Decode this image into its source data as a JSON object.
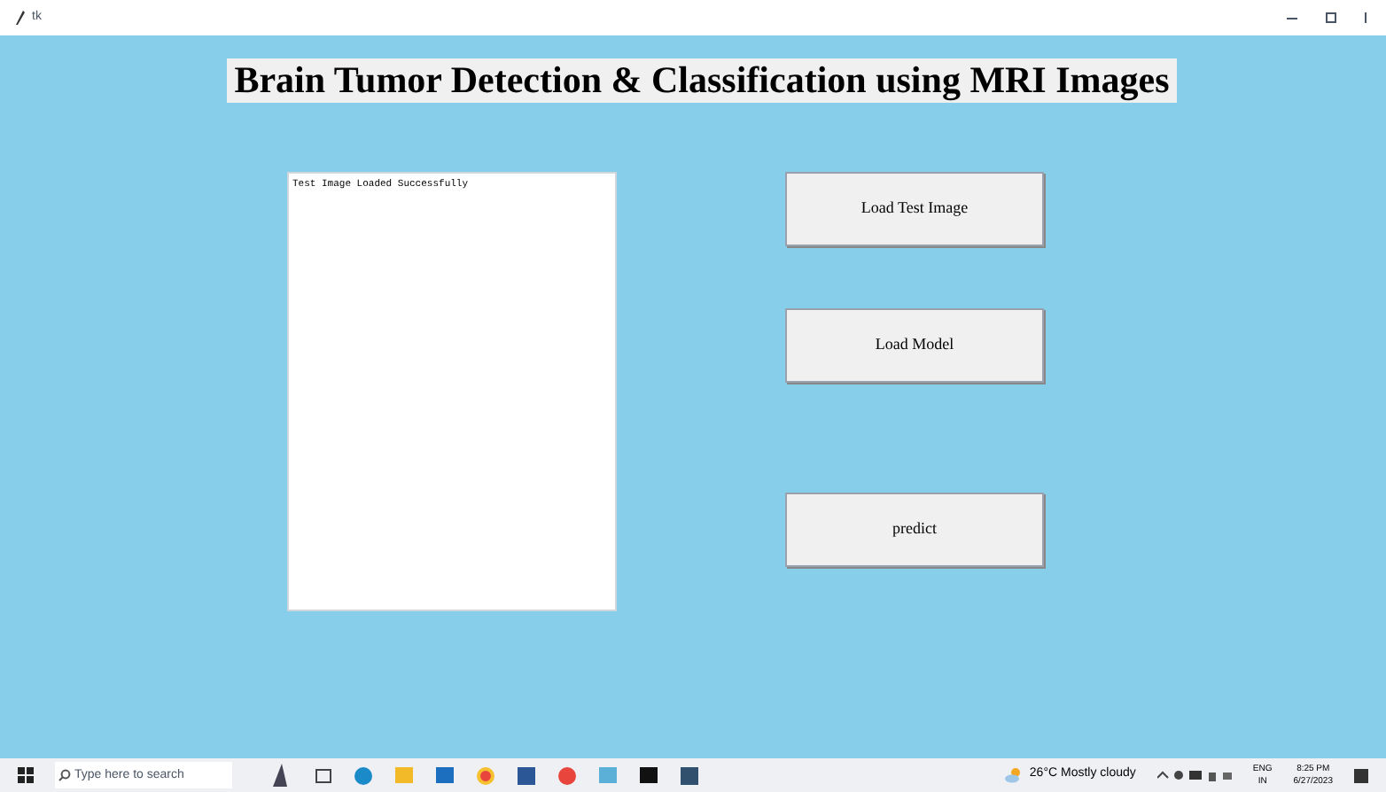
{
  "window": {
    "title": "tk"
  },
  "heading": "Brain Tumor Detection & Classification using MRI Images",
  "log": {
    "text": "Test Image Loaded Successfully"
  },
  "buttons": [
    {
      "label": "Load Test Image"
    },
    {
      "label": "Load Model"
    },
    {
      "label": "predict"
    }
  ],
  "taskbar": {
    "search": {
      "placeholder": "Type here to search"
    },
    "weather": "26°C  Mostly cloudy",
    "language": "ENG",
    "region": "IN",
    "time": "8:25 PM",
    "date": "6/27/2023"
  }
}
